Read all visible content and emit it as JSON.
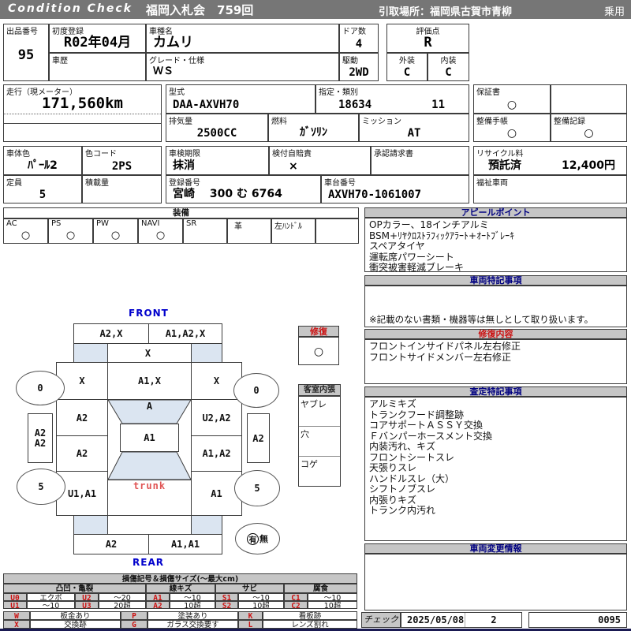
{
  "header": {
    "brand": "Condition  Check",
    "auction": "福岡入札会　759回",
    "pickup": "引取場所：福岡県古賀市青柳",
    "category": "乗用"
  },
  "info": {
    "lot_label": "出品番号",
    "lot": "95",
    "first_reg_label": "初度登録",
    "first_reg": "R02年04月",
    "model_label": "車種名",
    "model": "カムリ",
    "history_label": "車歴",
    "history": "",
    "grade_label": "グレード・仕様",
    "grade": "ＷＳ",
    "doors_label": "ドア数",
    "doors": "4",
    "drive_label": "駆動",
    "drive": "2WD",
    "score_label": "評価点",
    "score": "R",
    "exterior_label": "外装",
    "exterior": "C",
    "interior_label": "内装",
    "interior": "C"
  },
  "specs": {
    "mileage_label": "走行（現メーター）",
    "mileage": "171,560km",
    "model_code_label": "型式",
    "model_code": "DAA-AXVH70",
    "class_label": "指定・類別",
    "class1": "18634",
    "class2": "11",
    "displacement_label": "排気量",
    "displacement": "2500CC",
    "fuel_label": "燃料",
    "fuel": "ｶﾞｿﾘﾝ",
    "mission_label": "ミッション",
    "mission": "AT",
    "warranty_label": "保証書",
    "warranty": "○",
    "book_label": "整備手帳",
    "book": "○",
    "record_label": "整備記録",
    "record": "○"
  },
  "registration": {
    "color_label": "車体色",
    "color": "ﾊﾟｰﾙ2",
    "color_code_label": "色コード",
    "color_code": "2PS",
    "capacity_label": "定員",
    "capacity": "5",
    "load_label": "積載量",
    "load": "",
    "inspection_label": "車検期限",
    "inspection": "抹消",
    "insurance_label": "検付自賠責",
    "insurance": "×",
    "approval_label": "承認請求書",
    "approval": "",
    "reg_no_label": "登録番号",
    "reg_no": "宮崎　 300 む  6764",
    "chassis_label": "車台番号",
    "chassis": "AXVH70-1061007",
    "recycle_label": "リサイクル料",
    "recycle_status": "預託済",
    "recycle_fee": "12,400円",
    "welfare_label": "福祉車両",
    "welfare": ""
  },
  "equipment": {
    "title": "装備",
    "items": [
      {
        "label": "AC",
        "value": "○"
      },
      {
        "label": "PS",
        "value": "○"
      },
      {
        "label": "PW",
        "value": "○"
      },
      {
        "label": "NAVI",
        "value": "○"
      },
      {
        "label": "SR",
        "value": ""
      },
      {
        "label": "革",
        "value": ""
      },
      {
        "label": "左ﾊﾝﾄﾞﾙ",
        "value": ""
      },
      {
        "label": "",
        "value": ""
      }
    ]
  },
  "appeal": {
    "title": "アピールポイント",
    "lines": [
      "OPカラー、18インチアルミ",
      "BSM+ﾘﾔｸﾛｽﾄﾗﾌｨｯｸｱﾗｰﾄ+ｵｰﾄﾌﾞﾚｰｷ",
      "スペアタイヤ",
      "運転席パワーシート",
      "衝突被害軽減ブレーキ"
    ]
  },
  "vehicle_notes": {
    "title": "車両特記事項",
    "note": "※記載のない書類・機器等は無しとして取り扱います。"
  },
  "repair_details": {
    "title": "修復内容",
    "lines": [
      "フロントインサイドパネル左右修正",
      "フロントサイドメンバー左右修正"
    ]
  },
  "assessment": {
    "title": "査定特記事項",
    "lines": [
      "アルミキズ",
      "トランクフード調整跡",
      "コアサポートＡＳＳＹ交換",
      "Ｆバンパーホースメント交換",
      "内装汚れ、キズ",
      "フロントシートスレ",
      "天張りスレ",
      "ハンドルスレ（大）",
      "シフトノブスレ",
      "内張りキズ",
      "トランク内汚れ"
    ]
  },
  "changes": {
    "title": "車両変更情報"
  },
  "check": {
    "label": "チェック",
    "date": "2025/05/08",
    "num": "2",
    "code": "0095"
  },
  "diagram": {
    "front": "FRONT",
    "rear": "REAR",
    "trunk": "trunk",
    "front_bumper_l": "A2,X",
    "front_bumper_r": "A1,A2,X",
    "cowl": "X",
    "fender_l": "X",
    "hood": "A1,X",
    "fender_r": "X",
    "front_door_l": "A2",
    "windshield": "A",
    "front_door_r": "U2,A2",
    "roof": "A1",
    "rear_door_l": "A2",
    "rear_door_r": "A1,A2",
    "quarter_l": "U1,A1",
    "quarter_r": "A1",
    "rear_bumper_l": "A2",
    "rear_bumper_r": "A1,A1",
    "side_l_1": "A2",
    "side_l_2": "A2",
    "side_r": "A2",
    "tire_fl": "0",
    "tire_fr": "0",
    "tire_rl": "5",
    "tire_rr": "5",
    "spare_yes": "有",
    "spare_no": "無",
    "repair": {
      "title": "修復",
      "mark": "○"
    },
    "cabin": {
      "title": "客室内張",
      "rows": [
        "ヤブレ",
        "穴",
        "コゲ"
      ]
    }
  },
  "legend": {
    "title": "損傷記号＆損傷サイズ(～最大cm)",
    "groups": [
      "凸凹・亀裂",
      "線キズ",
      "サビ",
      "腐食"
    ],
    "r1": [
      "U0",
      "エクボ",
      "U2",
      "～20",
      "A1",
      "～10",
      "S1",
      "～10",
      "C1",
      "～10"
    ],
    "r2": [
      "U1",
      "～10",
      "U3",
      "20超",
      "A2",
      "10超",
      "S2",
      "10超",
      "C2",
      "10超"
    ],
    "r3": [
      "W",
      "板金あり",
      "P",
      "塗装あり",
      "K",
      "看板跡"
    ],
    "r4": [
      "X",
      "交換跡",
      "G",
      "ガラス交換要す",
      "L",
      "レンズ割れ"
    ]
  }
}
